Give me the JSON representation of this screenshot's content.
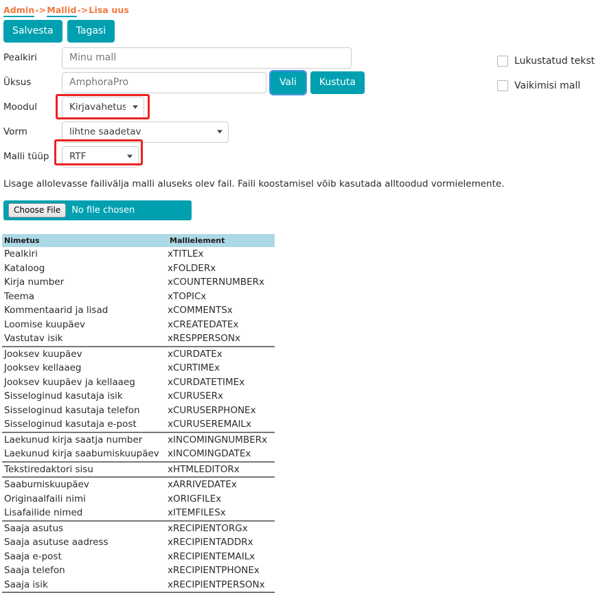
{
  "breadcrumb": {
    "items": [
      "Admin",
      "Mallid",
      "Lisa uus"
    ],
    "separator": "->",
    "color": "#f2763a",
    "underline_color": "#00a0b0"
  },
  "toolbar": {
    "save_label": "Salvesta",
    "back_label": "Tagasi",
    "accent_color": "#00a0b0"
  },
  "form": {
    "title_label": "Pealkiri",
    "title_value": "",
    "title_placeholder": "Minu mall",
    "unit_label": "Üksus",
    "unit_value": "",
    "unit_placeholder": "AmphoraPro",
    "unit_select_label": "Vali",
    "unit_delete_label": "Kustuta",
    "module_label": "Moodul",
    "module_value": "Kirjavahetus",
    "form_label": "Vorm",
    "form_value": "lihtne saadetav",
    "template_type_label": "Malli tüüp",
    "template_type_value": "RTF",
    "highlight_color": "#ee2020"
  },
  "options": {
    "locked_text_label": "Lukustatud tekst",
    "locked_text_checked": false,
    "default_template_label": "Vaikimisi mall",
    "default_template_checked": false
  },
  "upload": {
    "hint": "Lisage allolevasse failivälja malli aluseks olev fail. Faili koostamisel võib kasutada alltoodud vormielemente.",
    "choose_button_label": "Choose File",
    "no_file_label": "No file chosen"
  },
  "elements_table": {
    "headers": [
      "Nimetus",
      "Mallielement"
    ],
    "header_bg": "#add8e6",
    "rows": [
      {
        "name": "Pealkiri",
        "element": "xTITLEx",
        "group_end": false
      },
      {
        "name": "Kataloog",
        "element": "xFOLDERx",
        "group_end": false
      },
      {
        "name": "Kirja number",
        "element": "xCOUNTERNUMBERx",
        "group_end": false
      },
      {
        "name": "Teema",
        "element": "xTOPICx",
        "group_end": false
      },
      {
        "name": "Kommentaarid ja lisad",
        "element": "xCOMMENTSx",
        "group_end": false
      },
      {
        "name": "Loomise kuupäev",
        "element": "xCREATEDATEx",
        "group_end": false
      },
      {
        "name": "Vastutav isik",
        "element": "xRESPPERSONx",
        "group_end": true
      },
      {
        "name": "Jooksev kuupäev",
        "element": "xCURDATEx",
        "group_end": false
      },
      {
        "name": "Jooksev kellaaeg",
        "element": "xCURTIMEx",
        "group_end": false
      },
      {
        "name": "Jooksev kuupäev ja kellaaeg",
        "element": "xCURDATETIMEx",
        "group_end": false
      },
      {
        "name": "Sisseloginud kasutaja isik",
        "element": "xCURUSERx",
        "group_end": false
      },
      {
        "name": "Sisseloginud kasutaja telefon",
        "element": "xCURUSERPHONEx",
        "group_end": false
      },
      {
        "name": "Sisseloginud kasutaja e-post",
        "element": "xCURUSEREMAILx",
        "group_end": true
      },
      {
        "name": "Laekunud kirja saatja number",
        "element": "xINCOMINGNUMBERx",
        "group_end": false
      },
      {
        "name": "Laekunud kirja saabumiskuupäev",
        "element": "xINCOMINGDATEx",
        "group_end": true
      },
      {
        "name": "Tekstiredaktori sisu",
        "element": "xHTMLEDITORx",
        "group_end": true
      },
      {
        "name": "Saabumiskuupäev",
        "element": "xARRIVEDATEx",
        "group_end": false
      },
      {
        "name": "Originaalfaili nimi",
        "element": "xORIGFILEx",
        "group_end": false
      },
      {
        "name": "Lisafailide nimed",
        "element": "xITEMFILESx",
        "group_end": true
      },
      {
        "name": "Saaja asutus",
        "element": "xRECIPIENTORGx",
        "group_end": false
      },
      {
        "name": "Saaja asutuse aadress",
        "element": "xRECIPIENTADDRx",
        "group_end": false
      },
      {
        "name": "Saaja e-post",
        "element": "xRECIPIENTEMAILx",
        "group_end": false
      },
      {
        "name": "Saaja telefon",
        "element": "xRECIPIENTPHONEx",
        "group_end": false
      },
      {
        "name": "Saaja isik",
        "element": "xRECIPIENTPERSONx",
        "group_end": true
      }
    ]
  }
}
